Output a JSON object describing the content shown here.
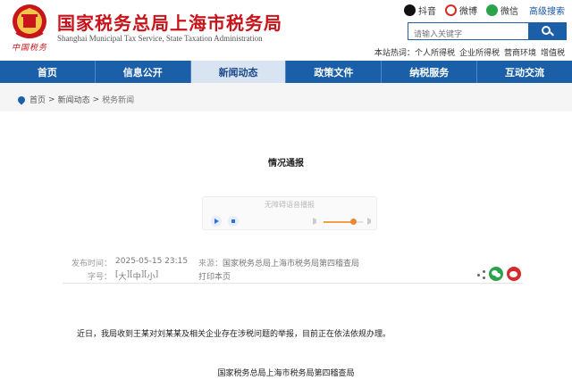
{
  "header": {
    "emblem_text": "中国税务",
    "title": "国家税务总局上海市税务局",
    "subtitle": "Shanghai Municipal Tax Service, State Taxation Administration",
    "social": [
      {
        "label": "抖音",
        "icon": "douyin-icon"
      },
      {
        "label": "微博",
        "icon": "weibo-icon"
      },
      {
        "label": "微信",
        "icon": "wechat-icon"
      }
    ],
    "advanced_search": "高级搜索",
    "search_placeholder": "请输入关键字",
    "hotwords_label": "本站热词：",
    "hotwords": [
      "个人所得税",
      "企业所得税",
      "营商环境",
      "增值税"
    ]
  },
  "nav": {
    "items": [
      "首页",
      "信息公开",
      "新闻动态",
      "政策文件",
      "纳税服务",
      "互动交流"
    ],
    "active_index": 2
  },
  "breadcrumb": {
    "items": [
      "首页",
      "新闻动态",
      "税务新闻"
    ],
    "separator": ">"
  },
  "article": {
    "title": "情况通报",
    "player_label": "无障碍语音播报",
    "volume_level": 0.75,
    "publish_label": "发布时间：",
    "publish_time": "2025-05-15 23:15",
    "source_label": "来源：",
    "source": "国家税务总局上海市税务局第四稽查局",
    "fontsize_label": "字号：",
    "fontsize_options": [
      "大",
      "中",
      "小"
    ],
    "print_label": "打印本页",
    "body": "近日，我局收到王某对刘某某及相关企业存在涉税问题的举报，目前正在依法依规办理。",
    "signature": "国家税务总局上海市税务局第四稽查局"
  },
  "colors": {
    "brand_red": "#c8141b",
    "nav_blue": "#1a5fa8",
    "active_tab": "#d8e4f2"
  }
}
